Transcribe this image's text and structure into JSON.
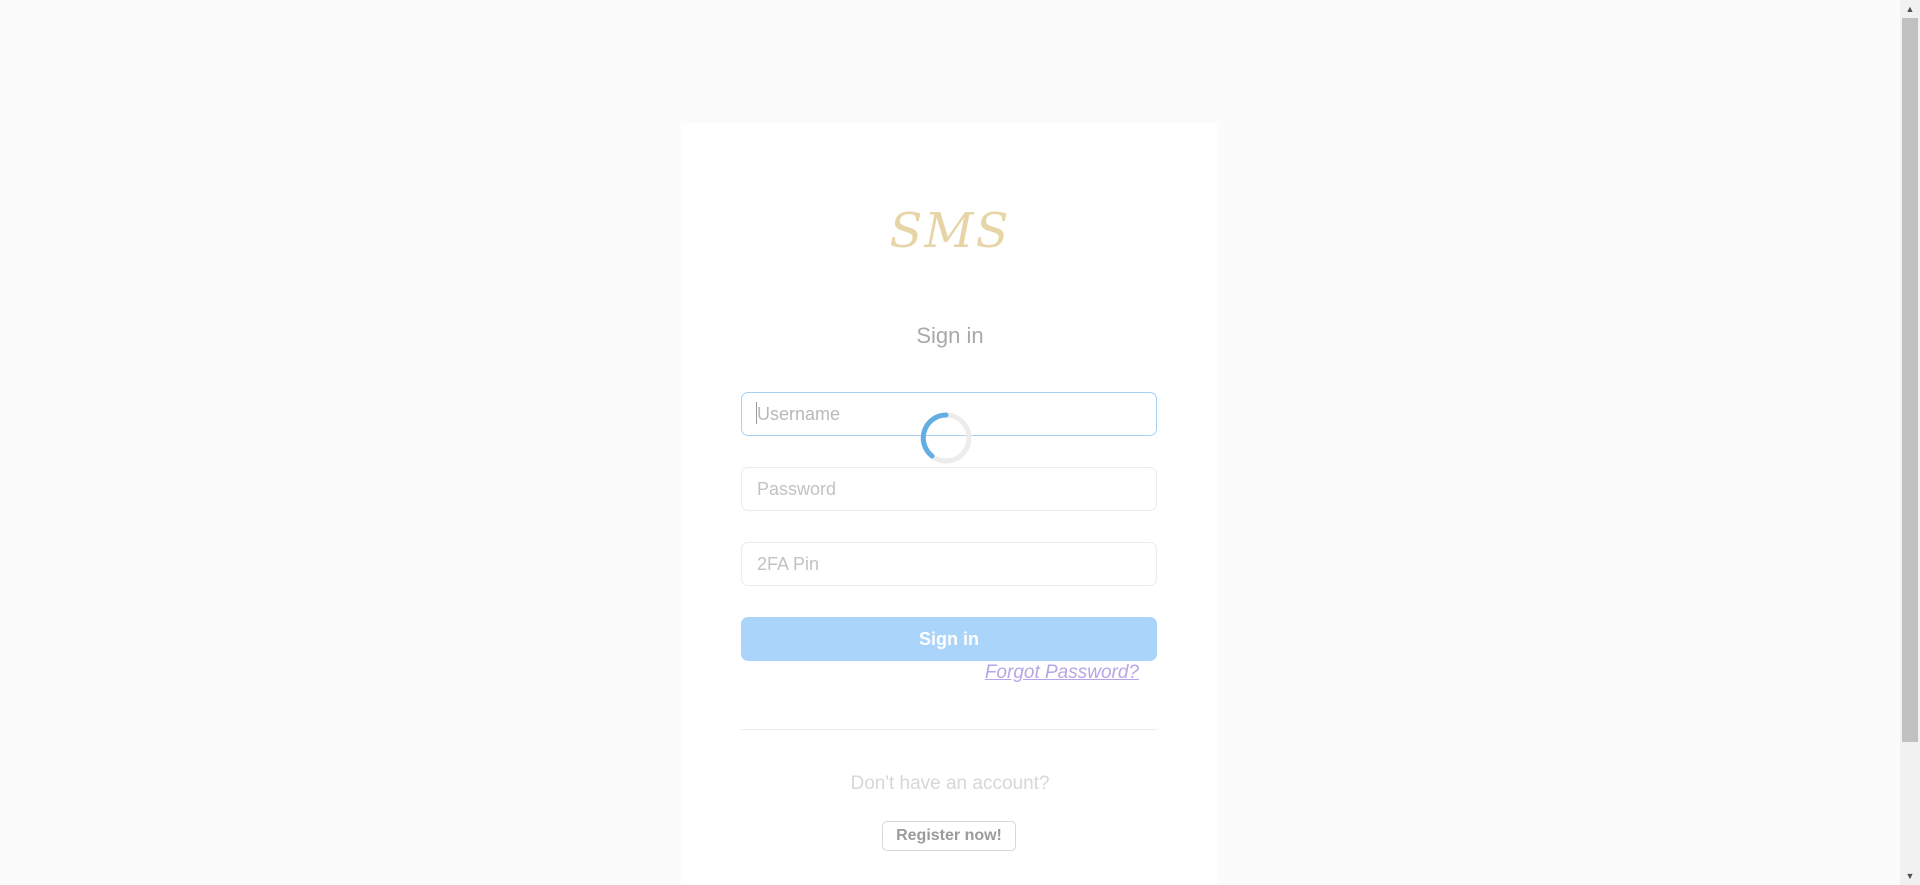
{
  "brand": {
    "logo_text": "SMS",
    "logo_color": "#e6d3a3"
  },
  "form": {
    "title": "Sign in",
    "username_placeholder": "Username",
    "password_placeholder": "Password",
    "pin_placeholder": "2FA Pin",
    "submit_label": "Sign in",
    "forgot_label": "Forgot Password?"
  },
  "register": {
    "prompt": "Don't have an account?",
    "button_label": "Register now!"
  },
  "state": {
    "loading": true,
    "spinner_icon": "loading-spinner-icon"
  },
  "colors": {
    "primary_button": "#abd4fb",
    "focus_border": "#a6d1f3",
    "link": "#b6a6e6",
    "spinner": "#4aa3e0"
  },
  "scrollbar": {
    "up_icon": "▲",
    "down_icon": "▼"
  }
}
